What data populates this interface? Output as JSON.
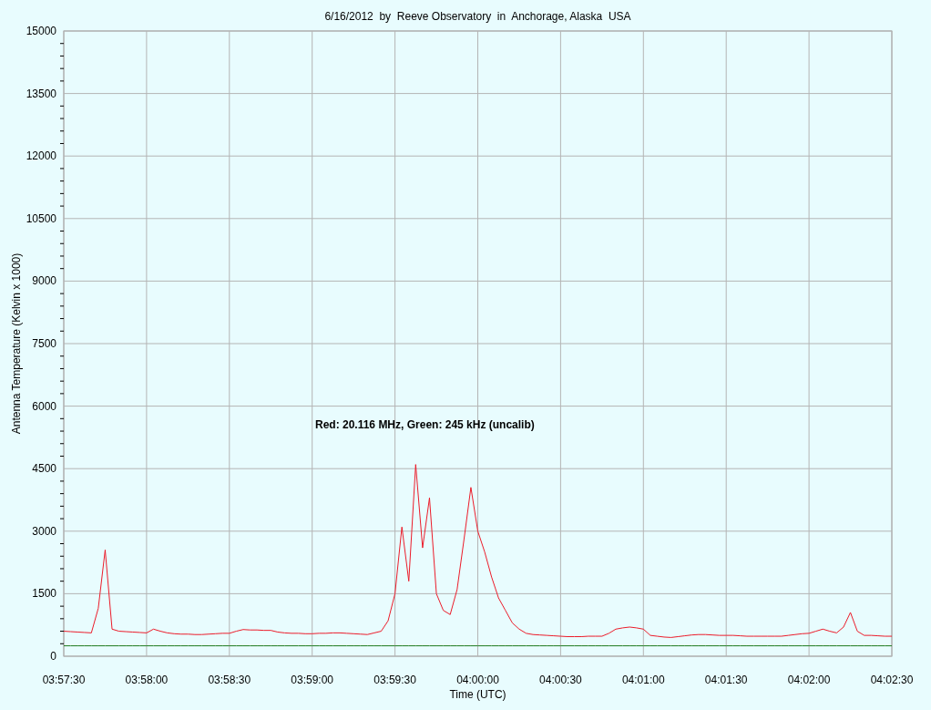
{
  "chart_data": {
    "type": "line",
    "title": "6/16/2012  by  Reeve Observatory  in  Anchorage, Alaska  USA",
    "xlabel": "Time (UTC)",
    "ylabel": "Antenna Temperature (Kelvin x 1000)",
    "categories": [
      "03:57:30",
      null,
      null,
      null,
      null,
      null,
      null,
      null,
      null,
      null,
      null,
      null,
      "03:58:00",
      null,
      null,
      null,
      null,
      null,
      null,
      null,
      null,
      null,
      null,
      null,
      "03:58:30",
      null,
      null,
      null,
      null,
      null,
      null,
      null,
      null,
      null,
      null,
      null,
      "03:59:00",
      null,
      null,
      null,
      null,
      null,
      null,
      null,
      null,
      null,
      null,
      null,
      "03:59:30",
      null,
      null,
      null,
      null,
      null,
      null,
      null,
      null,
      null,
      null,
      null,
      "04:00:00",
      null,
      null,
      null,
      null,
      null,
      null,
      null,
      null,
      null,
      null,
      null,
      "04:00:30",
      null,
      null,
      null,
      null,
      null,
      null,
      null,
      null,
      null,
      null,
      null,
      "04:01:00",
      null,
      null,
      null,
      null,
      null,
      null,
      null,
      null,
      null,
      null,
      null,
      "04:01:30",
      null,
      null,
      null,
      null,
      null,
      null,
      null,
      null,
      null,
      null,
      null,
      "04:02:00",
      null,
      null,
      null,
      null,
      null,
      null,
      null,
      null,
      null,
      null,
      null,
      "04:02:30"
    ],
    "series": [
      {
        "color": "#ec1c2a",
        "values": [
          600,
          590,
          580,
          570,
          560,
          1150,
          2550,
          650,
          600,
          590,
          580,
          570,
          560,
          650,
          600,
          560,
          540,
          530,
          530,
          520,
          520,
          530,
          540,
          550,
          550,
          600,
          640,
          630,
          630,
          620,
          620,
          580,
          560,
          550,
          550,
          540,
          540,
          550,
          550,
          560,
          560,
          550,
          540,
          530,
          520,
          560,
          600,
          850,
          1500,
          3100,
          1800,
          4600,
          2600,
          3800,
          1500,
          1100,
          1000,
          1600,
          2800,
          4050,
          3000,
          2500,
          1900,
          1400,
          1100,
          800,
          650,
          550,
          520,
          510,
          500,
          490,
          480,
          470,
          470,
          470,
          480,
          480,
          480,
          550,
          650,
          680,
          700,
          680,
          650,
          500,
          480,
          460,
          450,
          470,
          490,
          510,
          520,
          520,
          510,
          500,
          500,
          500,
          490,
          480,
          480,
          480,
          480,
          480,
          480,
          500,
          520,
          540,
          550,
          600,
          650,
          600,
          560,
          700,
          1050,
          600,
          500,
          500,
          490,
          480,
          480
        ]
      },
      {
        "color": "#1f7a1f",
        "values": [
          250,
          250,
          250,
          250,
          250,
          250,
          250,
          250,
          250,
          250,
          250,
          250,
          250,
          250,
          250,
          250,
          250,
          250,
          250,
          250,
          250,
          250,
          250,
          250,
          250,
          250,
          250,
          250,
          250,
          250,
          250,
          250,
          250,
          250,
          250,
          250,
          250,
          250,
          250,
          250,
          250,
          250,
          250,
          250,
          250,
          250,
          250,
          250,
          250,
          250,
          250,
          250,
          250,
          250,
          250,
          250,
          250,
          250,
          250,
          250,
          250,
          250,
          250,
          250,
          250,
          250,
          250,
          250,
          250,
          250,
          250,
          250,
          250,
          250,
          250,
          250,
          250,
          250,
          250,
          250,
          250,
          250,
          250,
          250,
          250,
          250,
          250,
          250,
          250,
          250,
          250,
          250,
          250,
          250,
          250,
          250,
          250,
          250,
          250,
          250,
          250,
          250,
          250,
          250,
          250,
          250,
          250,
          250,
          250,
          250,
          250,
          250,
          250,
          250,
          250,
          250,
          250,
          250,
          250,
          250,
          250
        ]
      }
    ],
    "grid": true,
    "ylim": [
      0,
      15000
    ],
    "yticks": [
      0,
      1500,
      3000,
      4500,
      6000,
      7500,
      9000,
      10500,
      12000,
      13500,
      15000
    ],
    "annotations": [
      "Red: 20.116 MHz, Green: 245 kHz (uncalib)"
    ]
  }
}
